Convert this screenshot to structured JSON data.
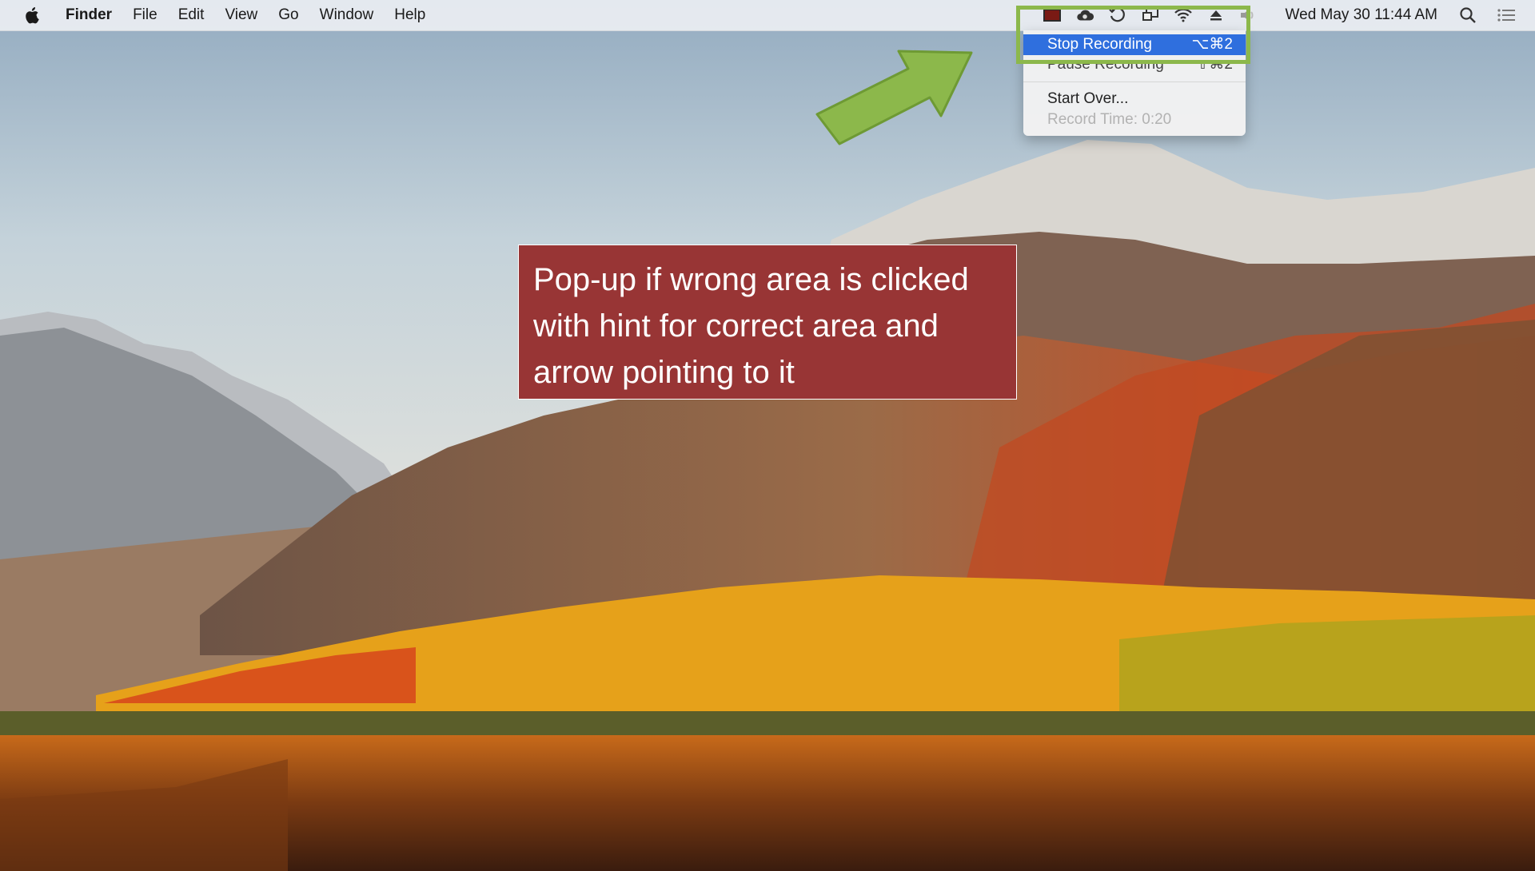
{
  "menubar": {
    "app_name": "Finder",
    "items": [
      "File",
      "Edit",
      "View",
      "Go",
      "Window",
      "Help"
    ],
    "clock": "Wed May 30  11:44 AM",
    "status_icons": [
      "screen-record-icon",
      "creative-cloud-icon",
      "time-machine-icon",
      "airplay-icon",
      "wifi-icon",
      "eject-icon",
      "volume-icon",
      "search-icon",
      "notification-list-icon"
    ]
  },
  "dropdown": {
    "stop_label": "Stop Recording",
    "stop_shortcut": "⌥⌘2",
    "pause_label": "Pause Recording",
    "pause_shortcut": "⇧⌘2",
    "start_over_label": "Start Over...",
    "record_time": "Record Time: 0:20"
  },
  "callout": {
    "text": "Pop-up if wrong area is clicked with hint for correct area and arrow pointing to it"
  },
  "colors": {
    "highlight": "#8cb84b",
    "callout_bg": "#983535",
    "selected_item": "#2f6fde"
  }
}
